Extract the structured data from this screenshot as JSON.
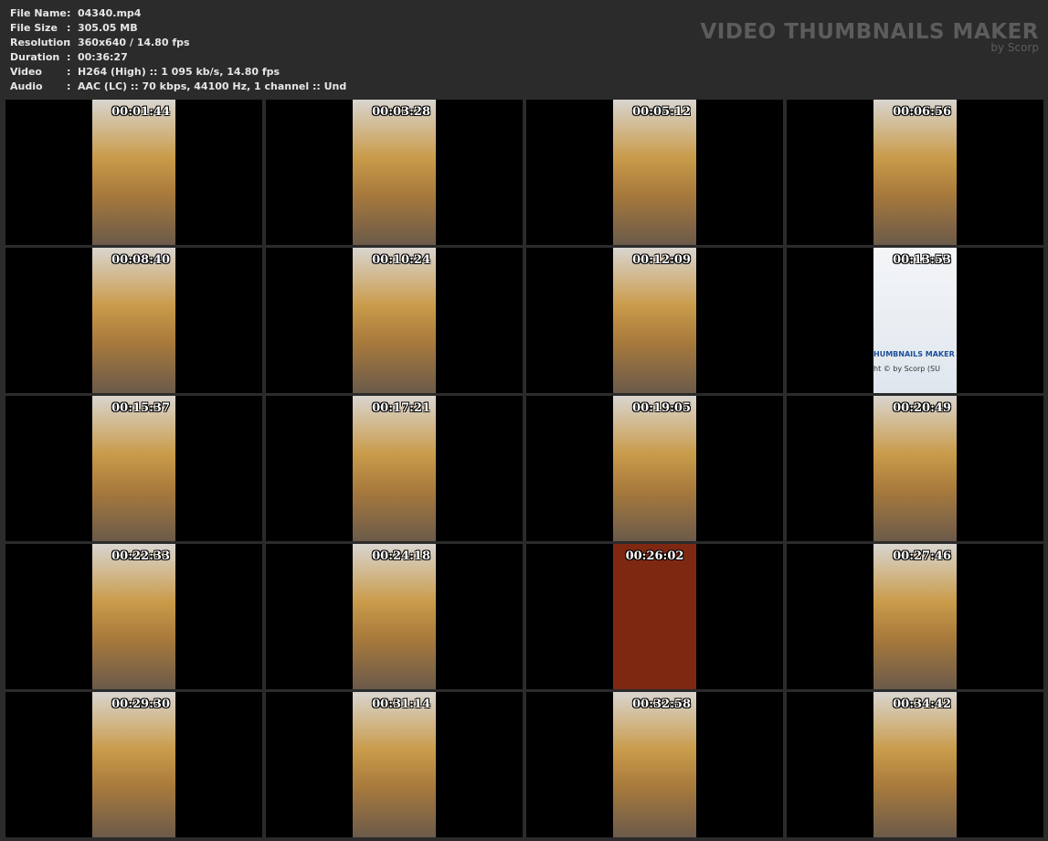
{
  "info": [
    {
      "label": "File Name",
      "value": "04340.mp4"
    },
    {
      "label": "File Size",
      "value": "305.05 MB"
    },
    {
      "label": "Resolution",
      "value": "360x640 / 14.80 fps"
    },
    {
      "label": "Duration",
      "value": "00:36:27"
    },
    {
      "label": "Video",
      "value": "H264 (High) :: 1 095 kb/s, 14.80 fps"
    },
    {
      "label": "Audio",
      "value": "AAC (LC) :: 70 kbps, 44100 Hz, 1 channel :: Und"
    }
  ],
  "separator": ":",
  "brand": {
    "title": "VIDEO THUMBNAILS MAKER",
    "subtitle": "by Scorp"
  },
  "thumbnails": [
    "00:01:44",
    "00:03:28",
    "00:05:12",
    "00:06:56",
    "00:08:40",
    "00:10:24",
    "00:12:09",
    "00:13:53",
    "00:15:37",
    "00:17:21",
    "00:19:05",
    "00:20:49",
    "00:22:33",
    "00:24:18",
    "00:26:02",
    "00:27:46",
    "00:29:30",
    "00:31:14",
    "00:32:58",
    "00:34:42"
  ],
  "logo_frame_text": [
    "HUMBNAILS MAKER",
    "ht © by Scorp (SU"
  ]
}
